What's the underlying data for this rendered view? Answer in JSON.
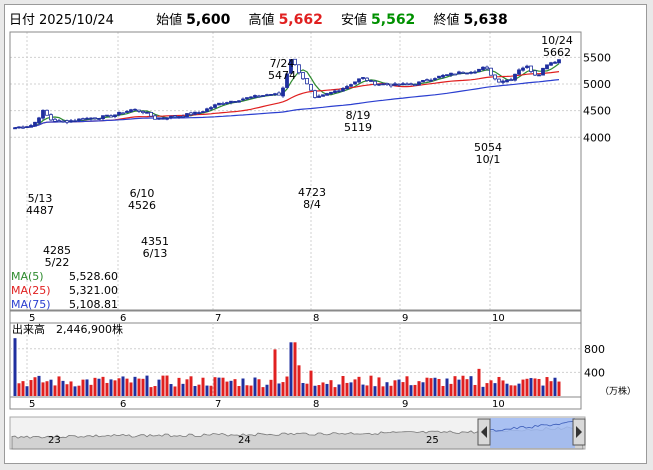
{
  "header": {
    "date_label": "日付",
    "date": "2025/10/24",
    "open_label": "始値",
    "open": "5,600",
    "high_label": "高値",
    "high": "5,662",
    "low_label": "安値",
    "low": "5,562",
    "close_label": "終値",
    "close": "5,638"
  },
  "colors": {
    "up_candle": "#1f2f9f",
    "down_candle": "#ffffff",
    "ma5": "#2e8b2e",
    "ma25": "#e02020",
    "ma75": "#2b3fd0",
    "volume_red": "#e02020",
    "volume_blue": "#1f2f9f",
    "high_value": "#e02020",
    "low_value": "#009000"
  },
  "price_axis": [
    "5500",
    "5000",
    "4500",
    "4000"
  ],
  "month_labels": [
    "5",
    "6",
    "7",
    "8",
    "9",
    "10"
  ],
  "annotations": [
    {
      "date": "5/13",
      "price": "4487"
    },
    {
      "date": "5/22",
      "price": "4285"
    },
    {
      "date": "6/10",
      "price": "4526"
    },
    {
      "date": "6/13",
      "price": "4351"
    },
    {
      "date": "7/24",
      "price": "5474"
    },
    {
      "date": "8/4",
      "price": "4723"
    },
    {
      "date": "8/19",
      "price": "5119"
    },
    {
      "date": "10/1",
      "price": "5054"
    },
    {
      "date": "10/24",
      "price": "5662"
    }
  ],
  "legend": {
    "ma5_label": "MA(5)",
    "ma5_value": "5,528.60",
    "ma25_label": "MA(25)",
    "ma25_value": "5,321.00",
    "ma75_label": "MA(75)",
    "ma75_value": "5,108.81"
  },
  "volume": {
    "label": "出来高",
    "value": "2,446,900株",
    "axis": [
      "800",
      "400"
    ],
    "unit": "（万株）"
  },
  "navigator": {
    "year_labels": [
      "23",
      "24",
      "25"
    ]
  },
  "chart_data": [
    {
      "type": "candlestick",
      "x_months": [
        "5",
        "6",
        "7",
        "8",
        "9",
        "10"
      ],
      "ylim": [
        3800,
        5800
      ],
      "key_points": [
        {
          "date": "5/13",
          "value": 4487
        },
        {
          "date": "5/22",
          "value": 4285
        },
        {
          "date": "6/10",
          "value": 4526
        },
        {
          "date": "6/13",
          "value": 4351
        },
        {
          "date": "7/24",
          "value": 5474
        },
        {
          "date": "8/4",
          "value": 4723
        },
        {
          "date": "8/19",
          "value": 5119
        },
        {
          "date": "10/1",
          "value": 5054
        },
        {
          "date": "10/24",
          "value": 5662
        }
      ],
      "last_bar": {
        "open": 5600,
        "high": 5662,
        "low": 5562,
        "close": 5638
      },
      "series": [
        {
          "name": "MA(5)",
          "last": 5528.6
        },
        {
          "name": "MA(25)",
          "last": 5321.0
        },
        {
          "name": "MA(75)",
          "last": 5108.81
        }
      ]
    },
    {
      "type": "bar",
      "name": "出来高",
      "unit": "万株",
      "ylim": [
        0,
        1000
      ],
      "last": 244.69
    }
  ]
}
